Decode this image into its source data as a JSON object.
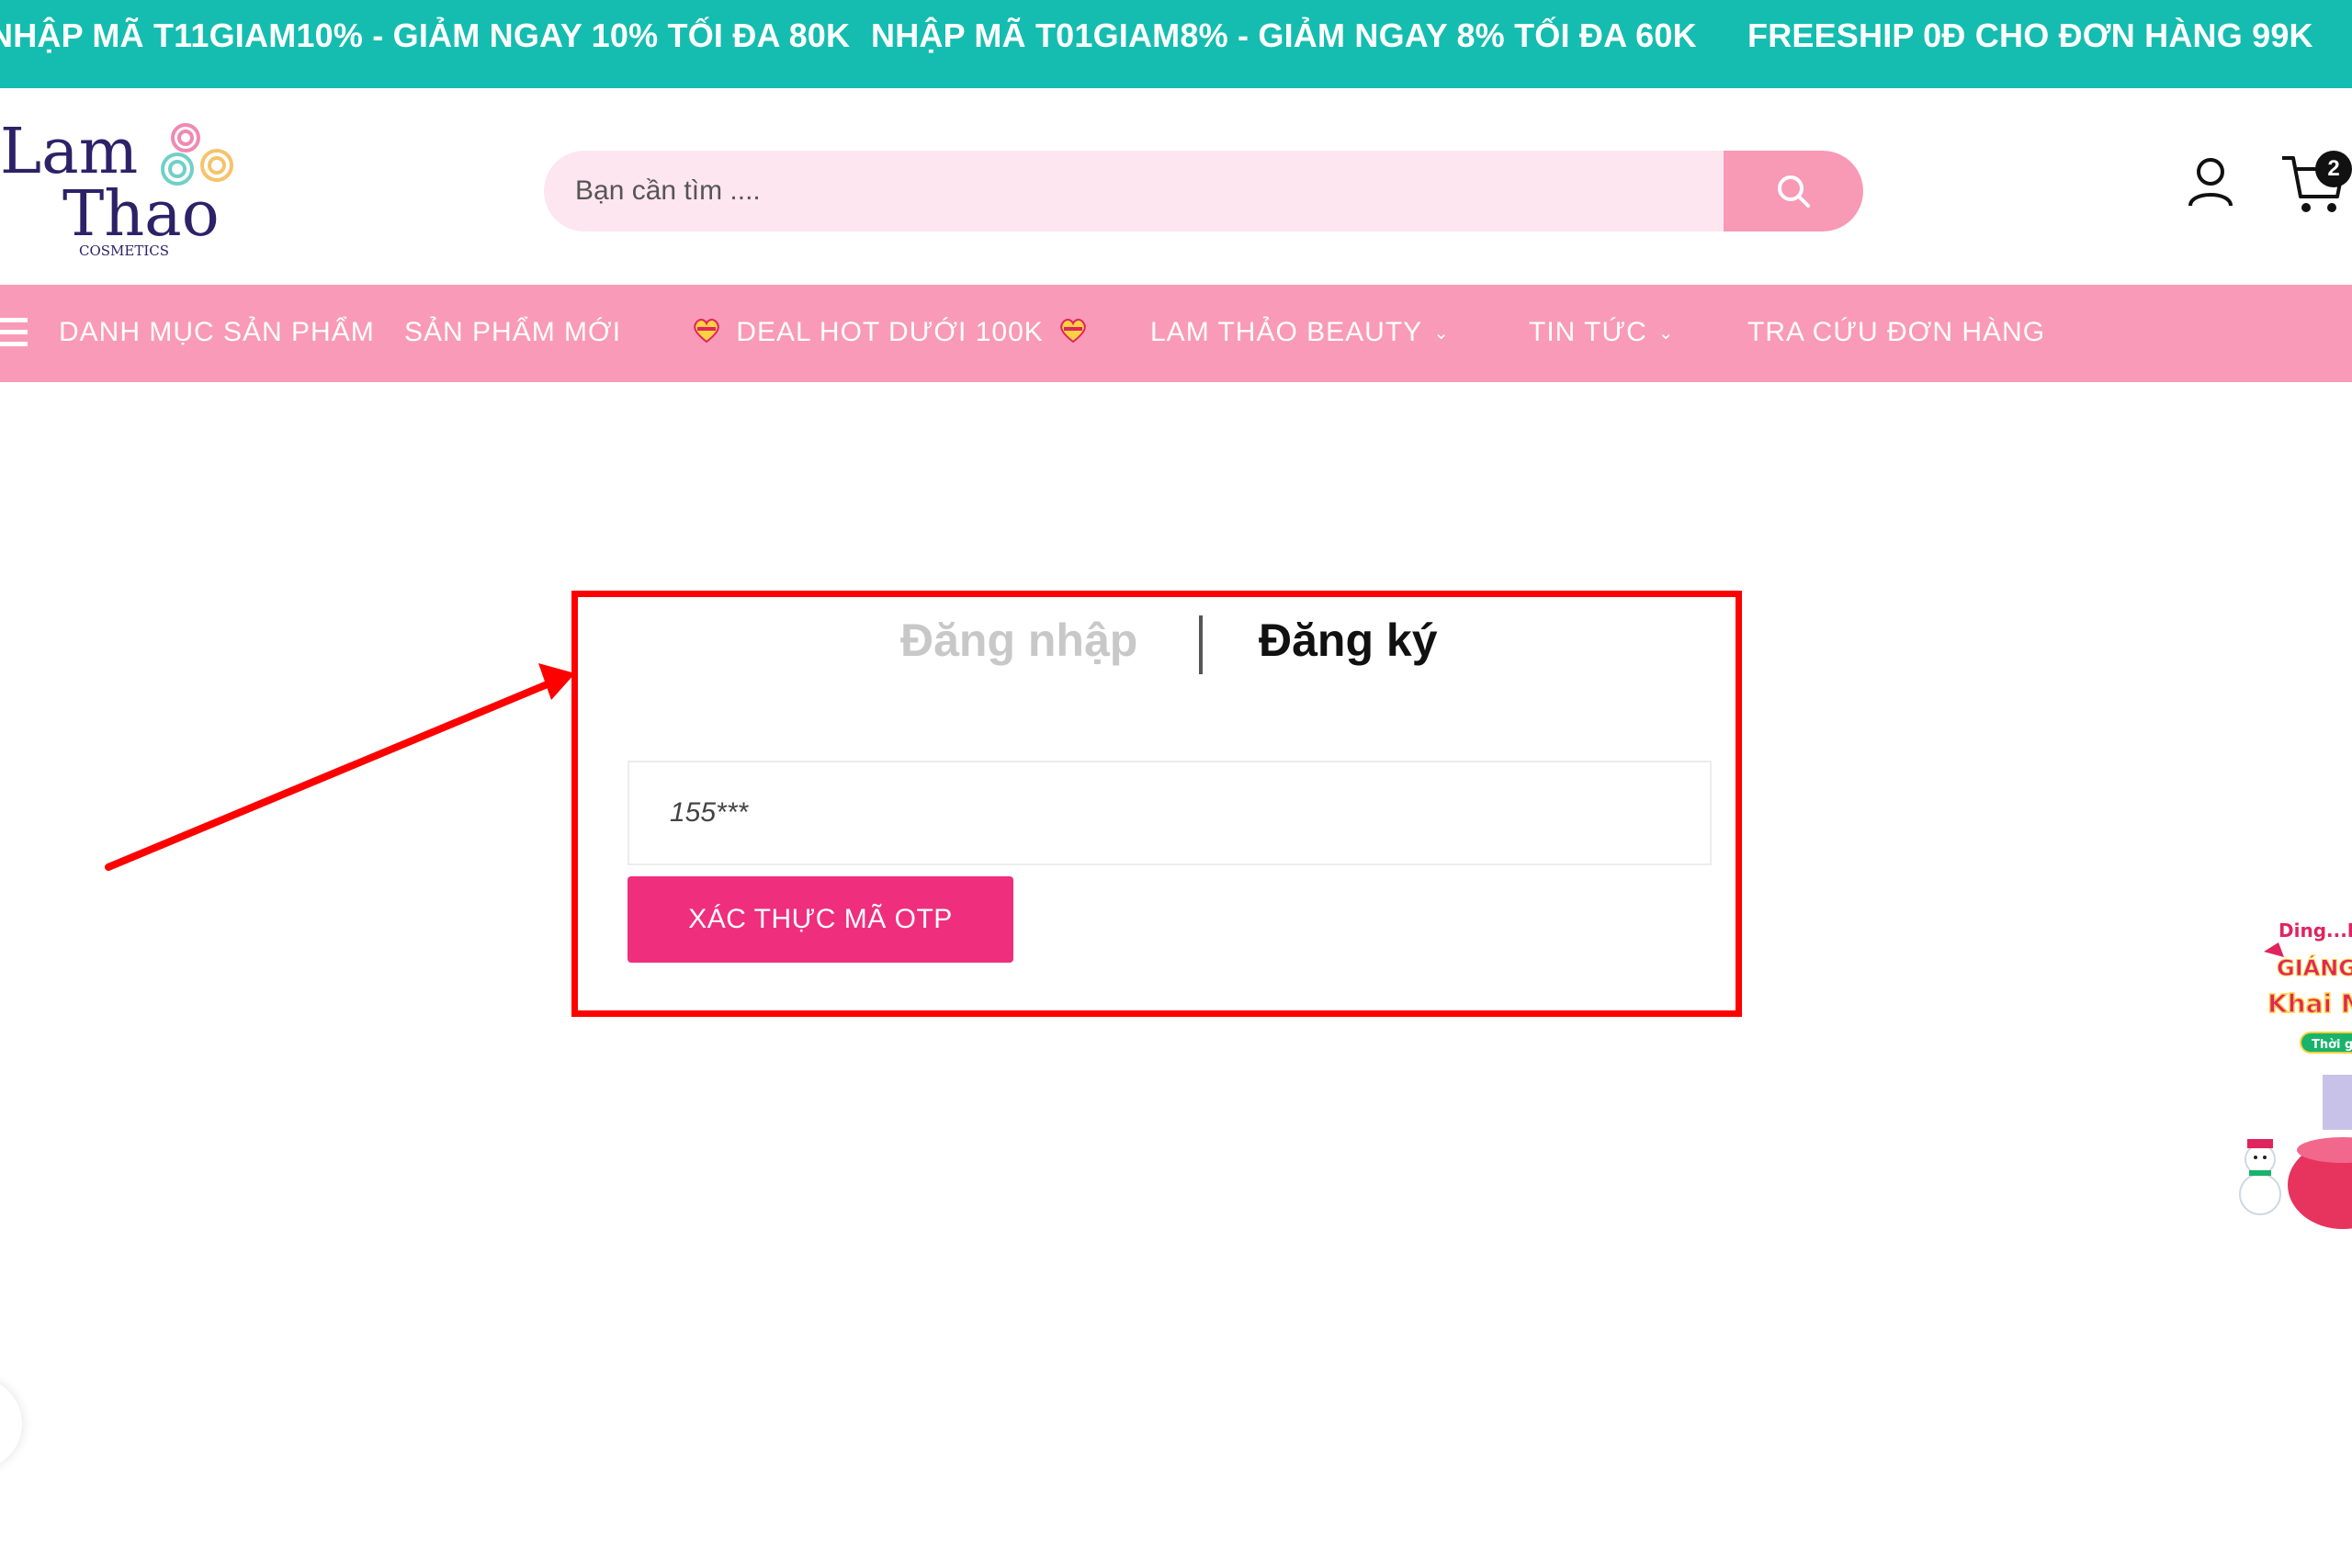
{
  "promo_bar": {
    "items": [
      "NHẬP MÃ T11GIAM10% - GIẢM NGAY 10% TỐI ĐA 80K",
      "NHẬP MÃ T01GIAM8% - GIẢM NGAY 8% TỐI ĐA 60K",
      "FREESHIP 0Đ CHO ĐƠN HÀNG 99K"
    ]
  },
  "header": {
    "logo": {
      "line1": "Lam",
      "line2": "Thao",
      "sub": "COSMETICS"
    },
    "search": {
      "placeholder": "Bạn cần tìm ...."
    },
    "cart": {
      "count": "2"
    }
  },
  "nav": {
    "items": [
      {
        "label": "DANH MỤC SẢN PHẨM"
      },
      {
        "label": "SẢN PHẨM MỚI"
      },
      {
        "label": "DEAL HOT DƯỚI 100K"
      },
      {
        "label": "LAM THẢO BEAUTY"
      },
      {
        "label": "TIN TỨC"
      },
      {
        "label": "TRA CỨU ĐƠN HÀNG"
      }
    ]
  },
  "auth": {
    "tabs": {
      "login": "Đăng nhập",
      "register": "Đăng ký"
    },
    "otp_field": {
      "value": "155***"
    },
    "verify_button": "XÁC THỰC MÃ OTP"
  },
  "side_promo": {
    "line1": "Ding...D",
    "line2": "GIÁNG",
    "line3": "Khai M",
    "line4": "Thời g"
  },
  "colors": {
    "promo_bg": "#14bdb0",
    "nav_bg": "#f99ab8",
    "search_bg": "#fde6ef",
    "search_btn": "#f899b6",
    "primary_button": "#ef2e7e",
    "annotation_red": "#ff0000"
  },
  "icons": [
    "search-icon",
    "account-icon",
    "cart-icon",
    "menu-icon",
    "heart-icon",
    "chevron-down-icon"
  ]
}
